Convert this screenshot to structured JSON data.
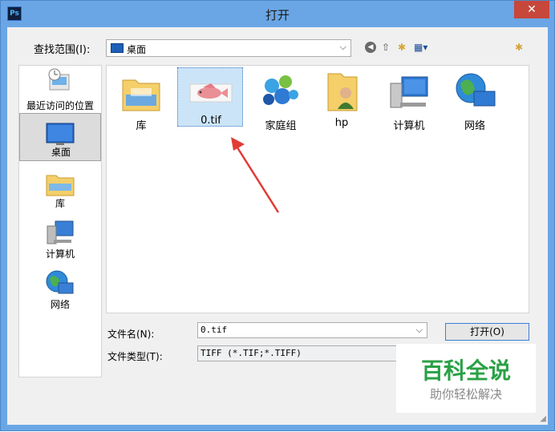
{
  "window": {
    "title": "打开",
    "app_icon": "Ps",
    "close_glyph": "✕"
  },
  "lookin": {
    "label": "查找范围(I):",
    "value": "桌面"
  },
  "toolbar": {
    "back": "◀",
    "up": "⇧",
    "new_folder": "✱",
    "view": "▦▾",
    "extra": "✱"
  },
  "places": [
    "最近访问的位置",
    "桌面",
    "库",
    "计算机",
    "网络"
  ],
  "files": [
    "库",
    "0.tif",
    "家庭组",
    "hp",
    "计算机",
    "网络"
  ],
  "form": {
    "filename_label": "文件名(N):",
    "filename_value": "0.tif",
    "filetype_label": "文件类型(T):",
    "filetype_value": "TIFF (*.TIF;*.TIFF)",
    "open_label": "打开(O)"
  },
  "watermark": {
    "title": "百科全说",
    "subtitle": "助你轻松解决"
  },
  "colors": {
    "titlebar": "#6aa6e6",
    "close": "#c7473a",
    "arrow": "#e23b34",
    "watermark_green": "#2aa146"
  }
}
